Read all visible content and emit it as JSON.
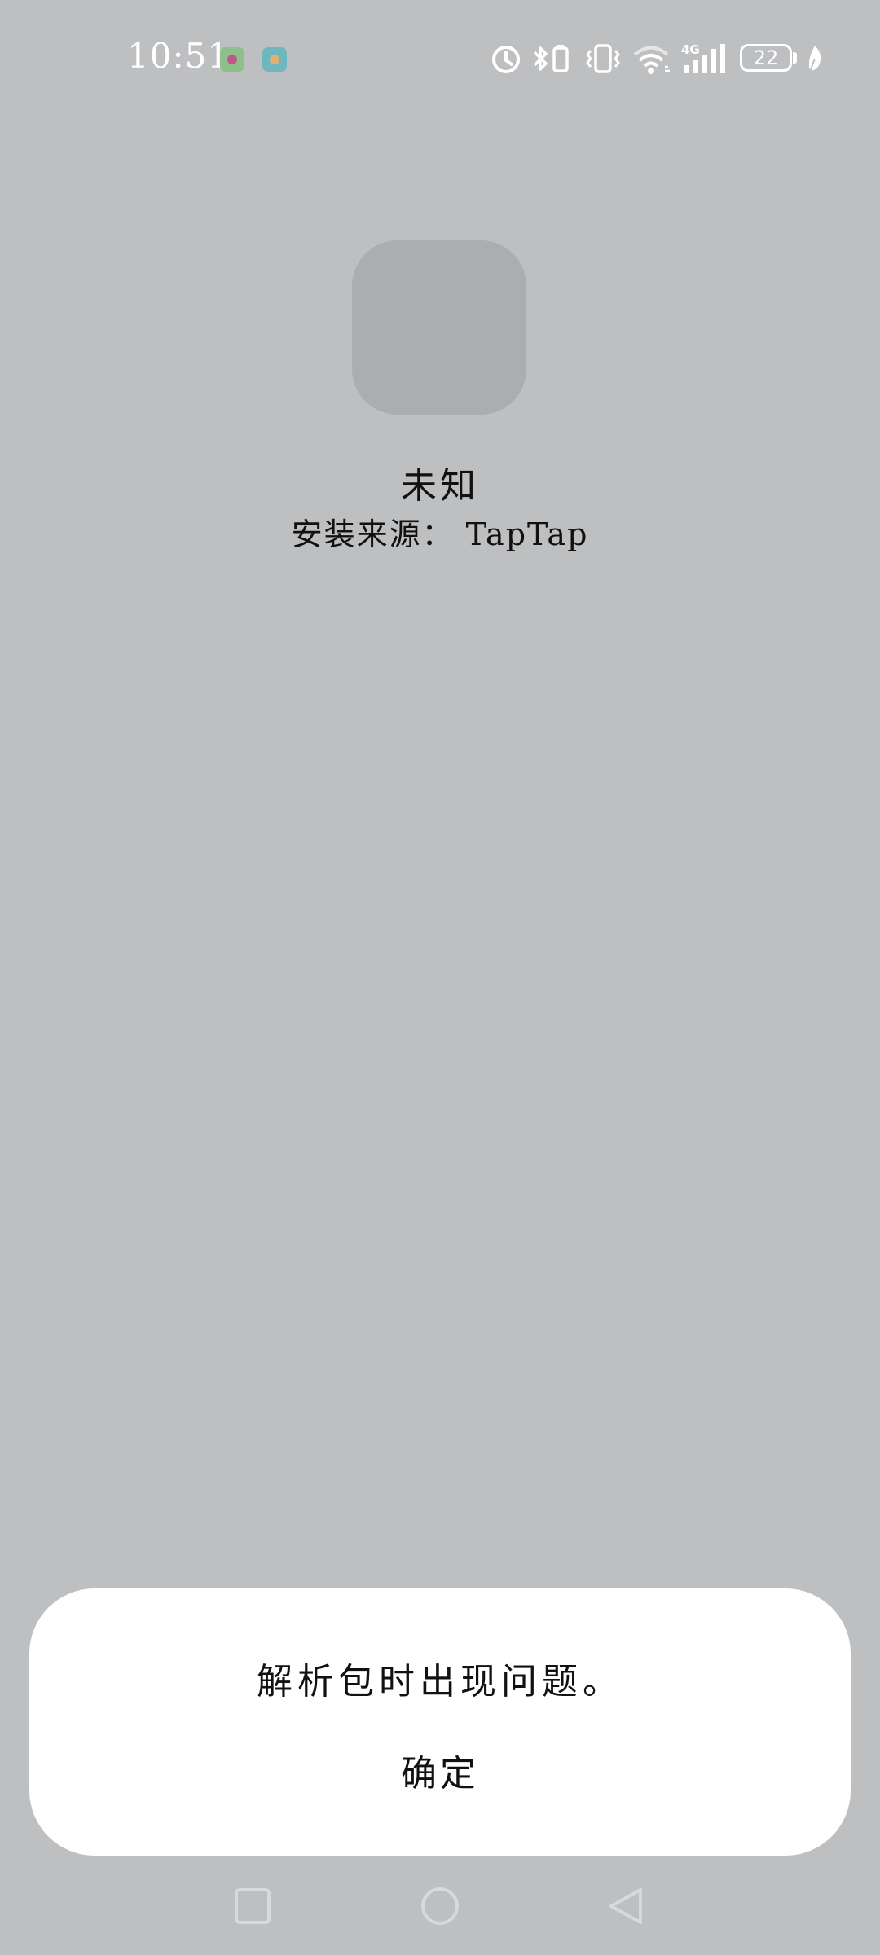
{
  "status_bar": {
    "time": "10:51",
    "battery_level": "22",
    "icons": [
      "app-notification-icon",
      "app-notification-icon",
      "alarm-icon",
      "bluetooth-battery-icon",
      "vibrate-icon",
      "wifi-icon",
      "signal-4g-icon",
      "battery-icon",
      "battery-saver-leaf-icon"
    ]
  },
  "app_info": {
    "name": "未知",
    "install_source": "安装来源： TapTap"
  },
  "dialog": {
    "message": "解析包时出现问题。",
    "confirm_label": "确定"
  },
  "nav_bar": {
    "icons": [
      "recent-apps-icon",
      "home-icon",
      "back-icon"
    ]
  },
  "colors": {
    "background": "#bebfc1",
    "dialog_background": "#ffffff",
    "icon_placeholder": "#acadaf"
  }
}
